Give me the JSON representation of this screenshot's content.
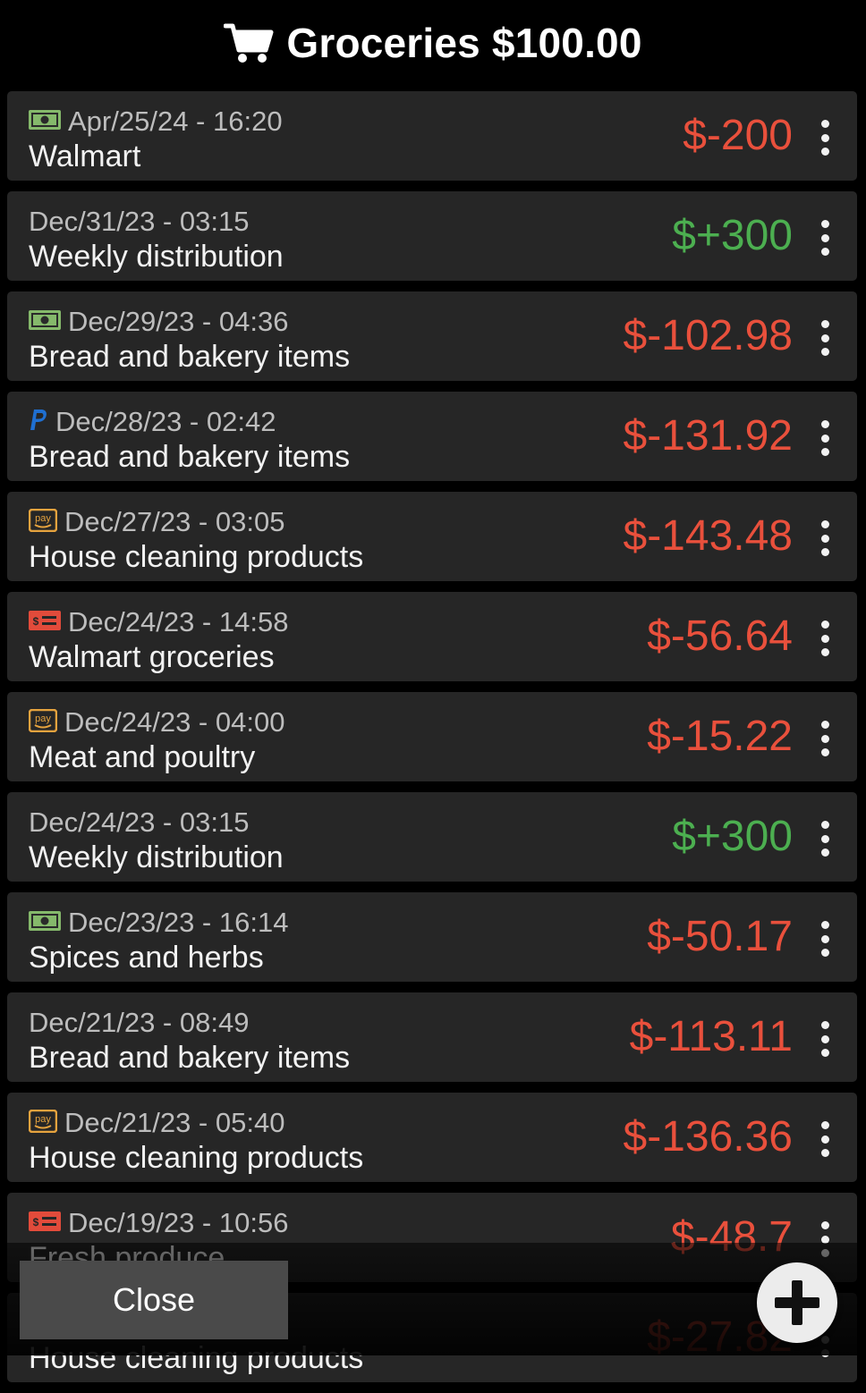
{
  "header": {
    "icon": "cart-icon",
    "title": "Groceries $100.00"
  },
  "colors": {
    "negative": "#e9503c",
    "positive": "#4caf50"
  },
  "transactions": [
    {
      "icon": "cash-icon",
      "date": "Apr/25/24 - 16:20",
      "description": "Walmart",
      "amount": "$-200",
      "sign": "negative"
    },
    {
      "icon": "",
      "date": "Dec/31/23 - 03:15",
      "description": "Weekly distribution",
      "amount": "$+300",
      "sign": "positive"
    },
    {
      "icon": "cash-icon",
      "date": "Dec/29/23 - 04:36",
      "description": "Bread and bakery items",
      "amount": "$-102.98",
      "sign": "negative"
    },
    {
      "icon": "paypal-icon",
      "date": "Dec/28/23 - 02:42",
      "description": "Bread and bakery items",
      "amount": "$-131.92",
      "sign": "negative"
    },
    {
      "icon": "amazon-pay-icon",
      "date": "Dec/27/23 - 03:05",
      "description": "House cleaning products",
      "amount": "$-143.48",
      "sign": "negative"
    },
    {
      "icon": "money-check-icon",
      "date": "Dec/24/23 - 14:58",
      "description": "Walmart groceries",
      "amount": "$-56.64",
      "sign": "negative"
    },
    {
      "icon": "amazon-pay-icon",
      "date": "Dec/24/23 - 04:00",
      "description": "Meat and poultry",
      "amount": "$-15.22",
      "sign": "negative"
    },
    {
      "icon": "",
      "date": "Dec/24/23 - 03:15",
      "description": "Weekly distribution",
      "amount": "$+300",
      "sign": "positive"
    },
    {
      "icon": "cash-icon",
      "date": "Dec/23/23 - 16:14",
      "description": "Spices and herbs",
      "amount": "$-50.17",
      "sign": "negative"
    },
    {
      "icon": "",
      "date": " Dec/21/23 - 08:49",
      "description": "Bread and bakery items",
      "amount": "$-113.11",
      "sign": "negative"
    },
    {
      "icon": "amazon-pay-icon",
      "date": "Dec/21/23 - 05:40",
      "description": "House cleaning products",
      "amount": "$-136.36",
      "sign": "negative"
    },
    {
      "icon": "money-check-icon",
      "date": "Dec/19/23 - 10:56",
      "description": "Fresh produce",
      "amount": "$-48.7",
      "sign": "negative"
    },
    {
      "icon": "",
      "date": "",
      "description": "House cleaning products",
      "amount": "$-27.82",
      "sign": "negative"
    }
  ],
  "footer": {
    "close_label": "Close",
    "add_icon": "plus-icon"
  }
}
